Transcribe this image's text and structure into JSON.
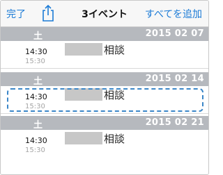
{
  "navbar": {
    "done_label": "完了",
    "share_icon": "share-icon",
    "title": "3イベント",
    "add_all_label": "すべてを追加"
  },
  "sections": [
    {
      "day_of_week": "土",
      "date": "2015 02 07",
      "event": {
        "start": "14:30",
        "end": "15:30",
        "title": "相談"
      }
    },
    {
      "day_of_week": "土",
      "date": "2015 02 14",
      "event": {
        "start": "14:30",
        "end": "15:30",
        "title": "相談"
      }
    },
    {
      "day_of_week": "土",
      "date": "2015 02 21",
      "event": {
        "start": "14:30",
        "end": "15:30",
        "title": "相談"
      }
    }
  ],
  "colors": {
    "accent": "#1a7ad6",
    "section_header": "#b6b9be",
    "highlight": "#3a86c8"
  }
}
